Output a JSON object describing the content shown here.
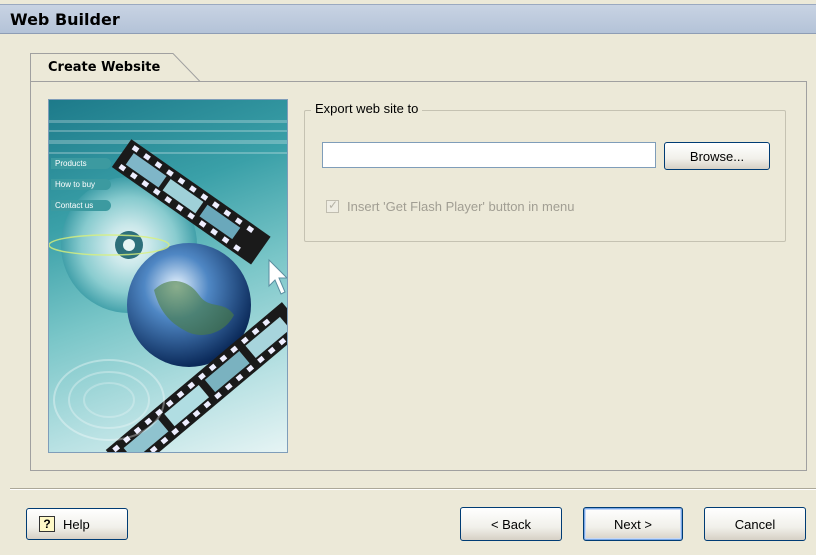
{
  "window": {
    "title": "Web Builder"
  },
  "tabs": [
    {
      "label": "Create Website",
      "active": true
    }
  ],
  "export_group": {
    "label": "Export web site to",
    "path_value": "",
    "browse_label": "Browse...",
    "flash_checkbox": {
      "label": "Insert 'Get Flash Player' button in menu",
      "checked": false,
      "enabled": false
    }
  },
  "hero_menu": [
    "Products",
    "How to buy",
    "Contact us"
  ],
  "footer": {
    "help_label": "Help",
    "help_icon": "question-mark-icon",
    "back_label": "< Back",
    "next_label": "Next >",
    "cancel_label": "Cancel"
  },
  "colors": {
    "titlebar": "#B4C3D8",
    "background": "#ECE9D8",
    "button_border": "#003C74"
  }
}
